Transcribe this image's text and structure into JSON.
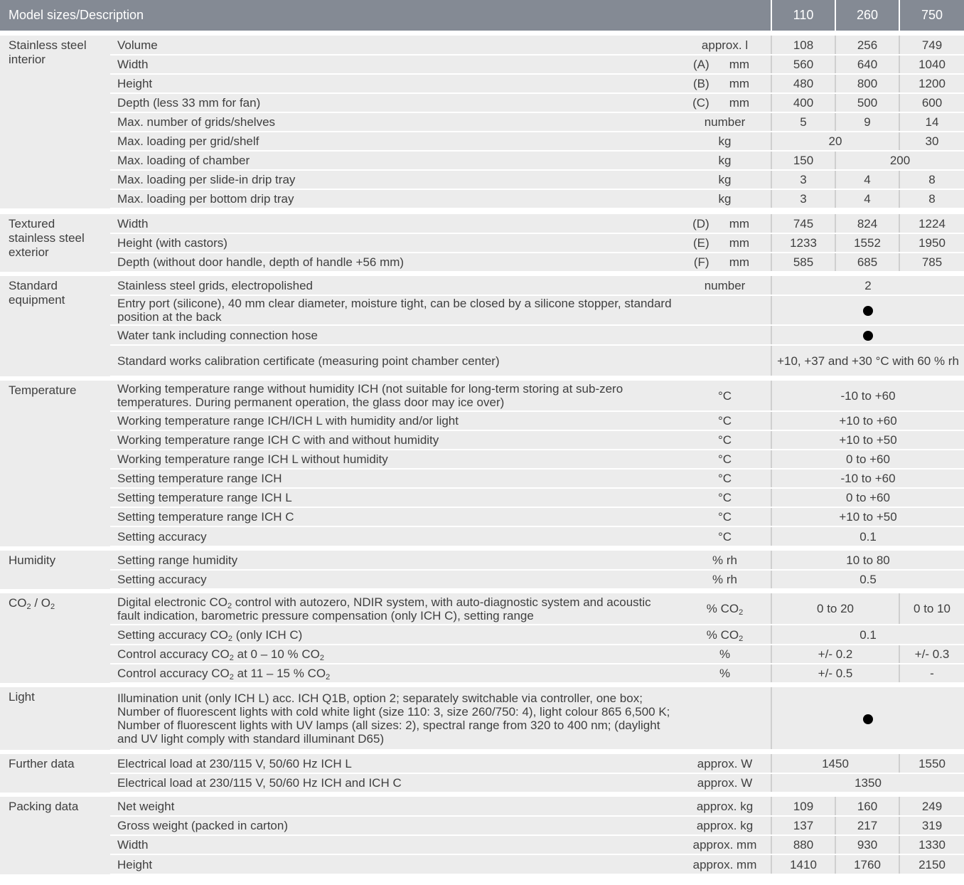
{
  "header": {
    "title": "Model sizes/Description",
    "models": [
      "110",
      "260",
      "750"
    ]
  },
  "sections": [
    {
      "name": "Stainless steel interior",
      "rows": [
        {
          "label": "Volume",
          "unit": "approx. l",
          "values": [
            "108",
            "256",
            "749"
          ]
        },
        {
          "label": "Width",
          "code": "(A)",
          "unit": "mm",
          "values": [
            "560",
            "640",
            "1040"
          ]
        },
        {
          "label": "Height",
          "code": "(B)",
          "unit": "mm",
          "values": [
            "480",
            "800",
            "1200"
          ]
        },
        {
          "label": "Depth (less 33 mm for fan)",
          "code": "(C)",
          "unit": "mm",
          "values": [
            "400",
            "500",
            "600"
          ]
        },
        {
          "label": "Max. number of grids/shelves",
          "unit": "number",
          "values": [
            "5",
            "9",
            "14"
          ]
        },
        {
          "label": "Max. loading per grid/shelf",
          "unit": "kg",
          "values": [
            "20",
            "30"
          ]
        },
        {
          "label": "Max. loading of chamber",
          "unit": "kg",
          "values": [
            "150",
            "200"
          ]
        },
        {
          "label": "Max. loading per slide-in drip tray",
          "unit": "kg",
          "values": [
            "3",
            "4",
            "8"
          ]
        },
        {
          "label": "Max. loading per bottom drip tray",
          "unit": "kg",
          "values": [
            "3",
            "4",
            "8"
          ]
        }
      ]
    },
    {
      "name": "Textured stainless steel exterior",
      "rows": [
        {
          "label": "Width",
          "code": "(D)",
          "unit": "mm",
          "values": [
            "745",
            "824",
            "1224"
          ]
        },
        {
          "label": "Height (with castors)",
          "code": "(E)",
          "unit": "mm",
          "values": [
            "1233",
            "1552",
            "1950"
          ]
        },
        {
          "label": "Depth (without door handle, depth of handle +56 mm)",
          "code": "(F)",
          "unit": "mm",
          "values": [
            "585",
            "685",
            "785"
          ]
        }
      ]
    },
    {
      "name": "Standard equipment",
      "rows": [
        {
          "label": "Stainless steel grids, electropolished",
          "unit": "number",
          "values": [
            "2"
          ]
        },
        {
          "label": "Entry port (silicone), 40 mm clear diameter, moisture tight, can be closed by a silicone stopper, standard position at the back",
          "unit": "",
          "values": [
            "●"
          ]
        },
        {
          "label": "Water tank including connection hose",
          "unit": "",
          "values": [
            "●"
          ]
        },
        {
          "label": "Standard works calibration certificate (measuring point chamber center)",
          "unit": "",
          "values": [
            "+10, +37 and +30 °C with 60 % rh"
          ]
        }
      ]
    },
    {
      "name": "Temperature",
      "rows": [
        {
          "label": "Working temperature range without humidity ICH (not suitable for long-term storing at sub-zero temperatures. During permanent operation, the glass door may ice over)",
          "unit": "°C",
          "values": [
            "-10 to +60"
          ]
        },
        {
          "label": "Working temperature range ICH/ICH L with humidity and/or light",
          "unit": "°C",
          "values": [
            "+10 to +60"
          ]
        },
        {
          "label": "Working temperature range ICH C with and without humidity",
          "unit": "°C",
          "values": [
            "+10 to +50"
          ]
        },
        {
          "label": "Working temperature range ICH L without humidity",
          "unit": "°C",
          "values": [
            "0 to +60"
          ]
        },
        {
          "label": "Setting temperature range ICH",
          "unit": "°C",
          "values": [
            "-10 to +60"
          ]
        },
        {
          "label": "Setting temperature range ICH L",
          "unit": "°C",
          "values": [
            "0 to +60"
          ]
        },
        {
          "label": "Setting temperature range ICH C",
          "unit": "°C",
          "values": [
            "+10 to +50"
          ]
        },
        {
          "label": "Setting accuracy",
          "unit": "°C",
          "values": [
            "0.1"
          ]
        }
      ]
    },
    {
      "name": "Humidity",
      "rows": [
        {
          "label": "Setting range humidity",
          "unit": "% rh",
          "values": [
            "10 to 80"
          ]
        },
        {
          "label": "Setting accuracy",
          "unit": "% rh",
          "values": [
            "0.5"
          ]
        }
      ]
    },
    {
      "name": "CO2 / O2",
      "rows": [
        {
          "label": "Digital electronic CO2 control with autozero, NDIR system, with auto-diagnostic system and acoustic fault indication, barometric pressure compensation (only ICH C), setting range",
          "unit": "% CO2",
          "values": [
            "0 to 20",
            "0 to 10"
          ]
        },
        {
          "label": "Setting accuracy CO2 (only ICH C)",
          "unit": "% CO2",
          "values": [
            "0.1"
          ]
        },
        {
          "label": "Control accuracy CO2 at 0 – 10 % CO2",
          "unit": "%",
          "values": [
            "+/- 0.2",
            "+/- 0.3"
          ]
        },
        {
          "label": "Control accuracy CO2 at 11 – 15 % CO2",
          "unit": "%",
          "values": [
            "+/- 0.5",
            "-"
          ]
        }
      ]
    },
    {
      "name": "Light",
      "rows": [
        {
          "label": "Illumination unit (only ICH L) acc. ICH Q1B, option 2; separately switchable via controller, one box; Number of fluorescent lights with cold white light (size 110: 3, size 260/750: 4), light colour 865 6,500 K; Number of fluorescent lights with UV lamps (all sizes: 2), spectral range from 320 to 400 nm; (daylight and UV light comply with standard illuminant D65)",
          "unit": "",
          "values": [
            "●"
          ]
        }
      ]
    },
    {
      "name": "Further data",
      "rows": [
        {
          "label": "Electrical load at 230/115 V, 50/60 Hz ICH L",
          "unit": "approx. W",
          "values": [
            "1450",
            "1550"
          ]
        },
        {
          "label": "Electrical load at 230/115 V, 50/60 Hz ICH and ICH C",
          "unit": "approx. W",
          "values": [
            "1350"
          ]
        }
      ]
    },
    {
      "name": "Packing data",
      "rows": [
        {
          "label": "Net weight",
          "unit": "approx. kg",
          "values": [
            "109",
            "160",
            "249"
          ]
        },
        {
          "label": "Gross weight (packed in carton)",
          "unit": "approx. kg",
          "values": [
            "137",
            "217",
            "319"
          ]
        },
        {
          "label": "Width",
          "unit": "approx. mm",
          "values": [
            "880",
            "930",
            "1330"
          ]
        },
        {
          "label": "Height",
          "unit": "approx. mm",
          "values": [
            "1410",
            "1760",
            "2150"
          ]
        }
      ]
    }
  ]
}
